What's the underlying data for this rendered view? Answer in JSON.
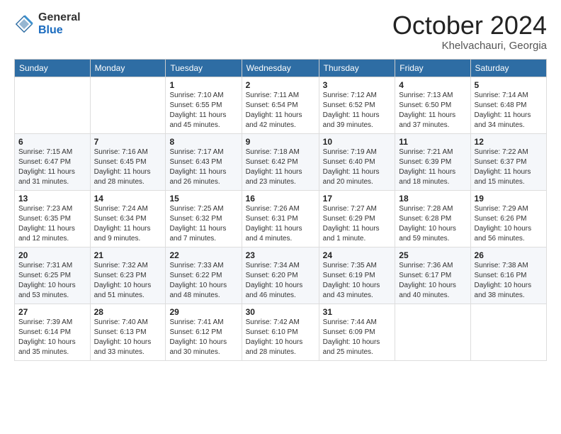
{
  "header": {
    "logo_general": "General",
    "logo_blue": "Blue",
    "title": "October 2024",
    "location": "Khelvachauri, Georgia"
  },
  "weekdays": [
    "Sunday",
    "Monday",
    "Tuesday",
    "Wednesday",
    "Thursday",
    "Friday",
    "Saturday"
  ],
  "weeks": [
    [
      {
        "day": "",
        "info": ""
      },
      {
        "day": "",
        "info": ""
      },
      {
        "day": "1",
        "info": "Sunrise: 7:10 AM\nSunset: 6:55 PM\nDaylight: 11 hours and 45 minutes."
      },
      {
        "day": "2",
        "info": "Sunrise: 7:11 AM\nSunset: 6:54 PM\nDaylight: 11 hours and 42 minutes."
      },
      {
        "day": "3",
        "info": "Sunrise: 7:12 AM\nSunset: 6:52 PM\nDaylight: 11 hours and 39 minutes."
      },
      {
        "day": "4",
        "info": "Sunrise: 7:13 AM\nSunset: 6:50 PM\nDaylight: 11 hours and 37 minutes."
      },
      {
        "day": "5",
        "info": "Sunrise: 7:14 AM\nSunset: 6:48 PM\nDaylight: 11 hours and 34 minutes."
      }
    ],
    [
      {
        "day": "6",
        "info": "Sunrise: 7:15 AM\nSunset: 6:47 PM\nDaylight: 11 hours and 31 minutes."
      },
      {
        "day": "7",
        "info": "Sunrise: 7:16 AM\nSunset: 6:45 PM\nDaylight: 11 hours and 28 minutes."
      },
      {
        "day": "8",
        "info": "Sunrise: 7:17 AM\nSunset: 6:43 PM\nDaylight: 11 hours and 26 minutes."
      },
      {
        "day": "9",
        "info": "Sunrise: 7:18 AM\nSunset: 6:42 PM\nDaylight: 11 hours and 23 minutes."
      },
      {
        "day": "10",
        "info": "Sunrise: 7:19 AM\nSunset: 6:40 PM\nDaylight: 11 hours and 20 minutes."
      },
      {
        "day": "11",
        "info": "Sunrise: 7:21 AM\nSunset: 6:39 PM\nDaylight: 11 hours and 18 minutes."
      },
      {
        "day": "12",
        "info": "Sunrise: 7:22 AM\nSunset: 6:37 PM\nDaylight: 11 hours and 15 minutes."
      }
    ],
    [
      {
        "day": "13",
        "info": "Sunrise: 7:23 AM\nSunset: 6:35 PM\nDaylight: 11 hours and 12 minutes."
      },
      {
        "day": "14",
        "info": "Sunrise: 7:24 AM\nSunset: 6:34 PM\nDaylight: 11 hours and 9 minutes."
      },
      {
        "day": "15",
        "info": "Sunrise: 7:25 AM\nSunset: 6:32 PM\nDaylight: 11 hours and 7 minutes."
      },
      {
        "day": "16",
        "info": "Sunrise: 7:26 AM\nSunset: 6:31 PM\nDaylight: 11 hours and 4 minutes."
      },
      {
        "day": "17",
        "info": "Sunrise: 7:27 AM\nSunset: 6:29 PM\nDaylight: 11 hours and 1 minute."
      },
      {
        "day": "18",
        "info": "Sunrise: 7:28 AM\nSunset: 6:28 PM\nDaylight: 10 hours and 59 minutes."
      },
      {
        "day": "19",
        "info": "Sunrise: 7:29 AM\nSunset: 6:26 PM\nDaylight: 10 hours and 56 minutes."
      }
    ],
    [
      {
        "day": "20",
        "info": "Sunrise: 7:31 AM\nSunset: 6:25 PM\nDaylight: 10 hours and 53 minutes."
      },
      {
        "day": "21",
        "info": "Sunrise: 7:32 AM\nSunset: 6:23 PM\nDaylight: 10 hours and 51 minutes."
      },
      {
        "day": "22",
        "info": "Sunrise: 7:33 AM\nSunset: 6:22 PM\nDaylight: 10 hours and 48 minutes."
      },
      {
        "day": "23",
        "info": "Sunrise: 7:34 AM\nSunset: 6:20 PM\nDaylight: 10 hours and 46 minutes."
      },
      {
        "day": "24",
        "info": "Sunrise: 7:35 AM\nSunset: 6:19 PM\nDaylight: 10 hours and 43 minutes."
      },
      {
        "day": "25",
        "info": "Sunrise: 7:36 AM\nSunset: 6:17 PM\nDaylight: 10 hours and 40 minutes."
      },
      {
        "day": "26",
        "info": "Sunrise: 7:38 AM\nSunset: 6:16 PM\nDaylight: 10 hours and 38 minutes."
      }
    ],
    [
      {
        "day": "27",
        "info": "Sunrise: 7:39 AM\nSunset: 6:14 PM\nDaylight: 10 hours and 35 minutes."
      },
      {
        "day": "28",
        "info": "Sunrise: 7:40 AM\nSunset: 6:13 PM\nDaylight: 10 hours and 33 minutes."
      },
      {
        "day": "29",
        "info": "Sunrise: 7:41 AM\nSunset: 6:12 PM\nDaylight: 10 hours and 30 minutes."
      },
      {
        "day": "30",
        "info": "Sunrise: 7:42 AM\nSunset: 6:10 PM\nDaylight: 10 hours and 28 minutes."
      },
      {
        "day": "31",
        "info": "Sunrise: 7:44 AM\nSunset: 6:09 PM\nDaylight: 10 hours and 25 minutes."
      },
      {
        "day": "",
        "info": ""
      },
      {
        "day": "",
        "info": ""
      }
    ]
  ]
}
